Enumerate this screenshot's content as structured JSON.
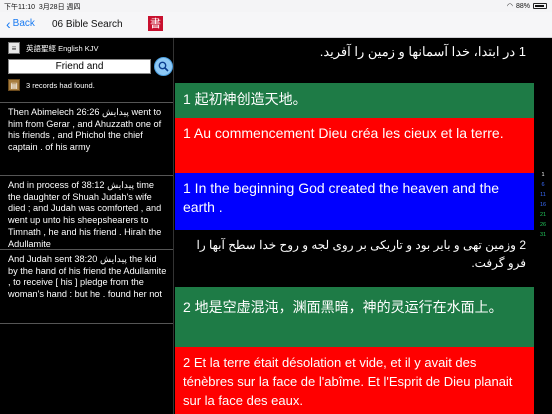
{
  "status": {
    "time": "下午11:10",
    "date": "3月28日 週四",
    "battery": "88%",
    "battery_level": 0.88
  },
  "nav": {
    "back_label": "Back",
    "title": "06 Bible Search",
    "logo_glyph": "書"
  },
  "sidebar": {
    "book_label": "英語聖經 English KJV",
    "search_value": "Friend and",
    "count_label": "3 records had found.",
    "results": [
      {
        "text": "Then Abimelech 26:26 پیدایش went to him from Gerar , and Ahuzzath one of his friends , and Phichol the chief captain . of his army"
      },
      {
        "text": "And in process of 38:12 پیدایش time the daughter of Shuah Judah's wife died ; and Judah was comforted , and went up unto his sheepshearers to Timnath , he and his friend . Hirah the Adullamite"
      },
      {
        "text": "And Judah sent 38:20 پیدایش the kid by the hand of his friend the Adullamite , to receive [ his ] pledge from the woman's hand : but he . found her not"
      }
    ]
  },
  "verses": [
    {
      "text": "1 در ابتدا، خدا آسمانها و زمین را آفرید.",
      "color": "#000000"
    },
    {
      "text": "1 起初神创造天地。",
      "color": "#1e7b46"
    },
    {
      "text": "1 Au commencement Dieu créa les cieux et la terre.",
      "color": "#ff0000"
    },
    {
      "text": "1 In the beginning God created the heaven and the earth .",
      "color": "#0000ff"
    },
    {
      "text": "2 وزمین تهی و بایر بود و تاریکی بر روی لجه و روح خدا سطح آبها را فرو گرفت.",
      "color": "#000000"
    },
    {
      "text": "2 地是空虚混沌，渊面黑暗，神的灵运行在水面上。",
      "color": "#1e7b46"
    },
    {
      "text": "2 Et la terre était désolation et vide, et il y avait des ténèbres sur la face de l'abîme. Et l'Esprit de Dieu planait sur la face des eaux.",
      "color": "#ff0000"
    }
  ],
  "pagebar": {
    "numbers": [
      "1",
      "6",
      "11",
      "16",
      "21",
      "26",
      "31"
    ],
    "colors": [
      "#ffffff",
      "#3a6dff",
      "#3a6dff",
      "#3a6dff",
      "#22c35a",
      "#22c35a",
      "#22c35a"
    ]
  }
}
